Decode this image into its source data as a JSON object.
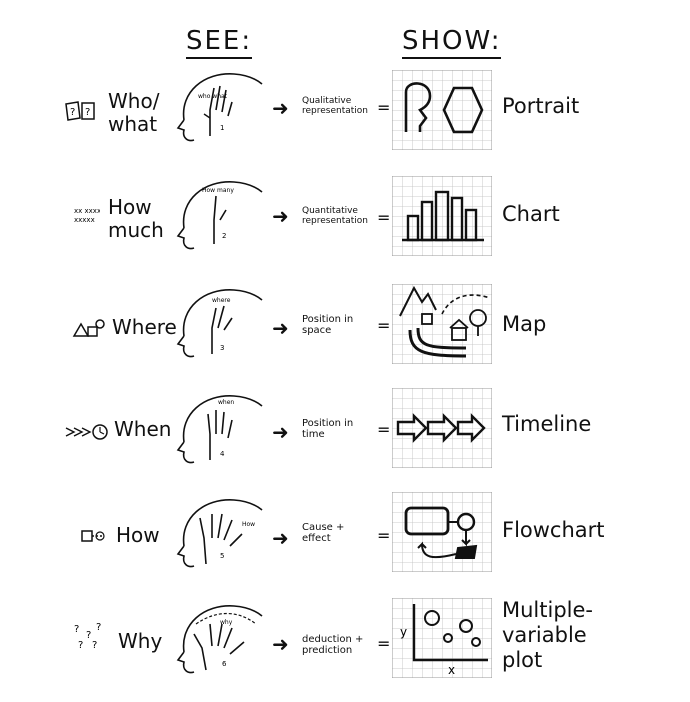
{
  "headers": {
    "see": "SEE:",
    "show": "SHOW:"
  },
  "rows": [
    {
      "label": "Who/ what",
      "see_icon": "question-cards-icon",
      "representation": "Qualitative representation",
      "result": "Portrait",
      "number": "1"
    },
    {
      "label": "How much",
      "see_icon": "count-marks-icon",
      "representation": "Quantitative representation",
      "result": "Chart",
      "number": "2"
    },
    {
      "label": "Where",
      "see_icon": "shapes-cluster-icon",
      "representation": "Position in space",
      "result": "Map",
      "number": "3"
    },
    {
      "label": "When",
      "see_icon": "arrow-clock-icon",
      "representation": "Position in time",
      "result": "Timeline",
      "number": "4"
    },
    {
      "label": "How",
      "see_icon": "process-box-icon",
      "representation": "Cause + effect",
      "result": "Flowchart",
      "number": "5"
    },
    {
      "label": "Why",
      "see_icon": "question-marks-icon",
      "representation": "deduction + prediction",
      "result": "Multiple-variable plot",
      "number": "6"
    }
  ],
  "symbols": {
    "arrow": "➜",
    "equals": "=",
    "question": "?"
  },
  "plot_axes": {
    "y": "y",
    "x": "x"
  },
  "head_words": [
    "who what",
    "How many",
    "where",
    "when",
    "How",
    "why"
  ],
  "colors": {
    "ink": "#111111",
    "grid": "#bdbdbd",
    "paper": "#ffffff"
  }
}
